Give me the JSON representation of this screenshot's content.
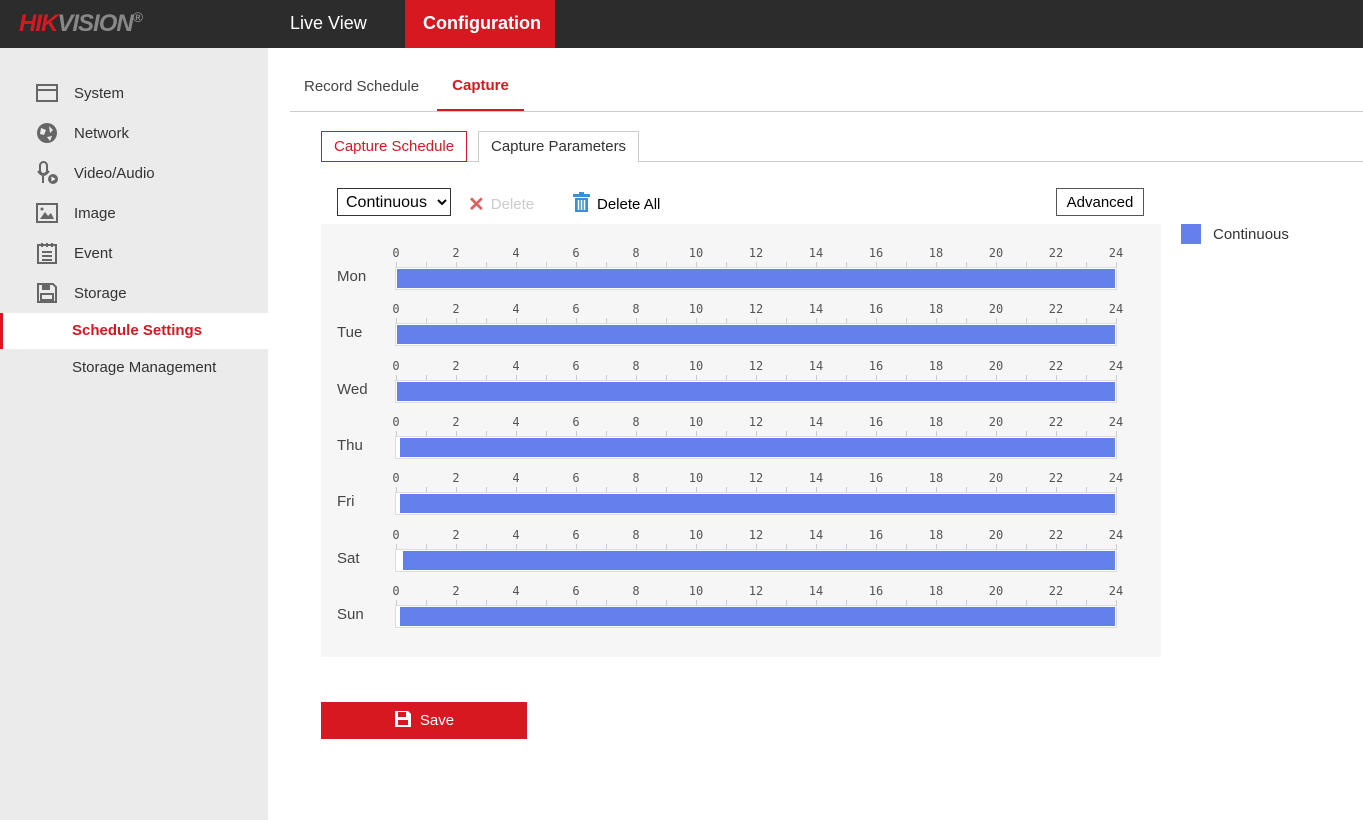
{
  "header": {
    "logo": "HIKVISION",
    "nav": [
      {
        "label": "Live View"
      },
      {
        "label": "Configuration",
        "active": true
      }
    ]
  },
  "sidebar": {
    "items": [
      {
        "label": "System",
        "icon": "window-icon"
      },
      {
        "label": "Network",
        "icon": "globe-icon"
      },
      {
        "label": "Video/Audio",
        "icon": "microphone-icon"
      },
      {
        "label": "Image",
        "icon": "image-icon"
      },
      {
        "label": "Event",
        "icon": "calendar-icon"
      },
      {
        "label": "Storage",
        "icon": "floppy-icon"
      }
    ],
    "subitems": [
      {
        "label": "Schedule Settings",
        "active": true
      },
      {
        "label": "Storage Management"
      }
    ]
  },
  "tabs": [
    {
      "label": "Record Schedule"
    },
    {
      "label": "Capture",
      "active": true
    }
  ],
  "subtabs": [
    {
      "label": "Capture Schedule",
      "active": true
    },
    {
      "label": "Capture Parameters"
    }
  ],
  "toolbar": {
    "mode": "Continuous",
    "delete": "Delete",
    "delete_all": "Delete All",
    "advanced": "Advanced"
  },
  "legend": {
    "label": "Continuous",
    "color": "#6480ea"
  },
  "schedule": {
    "hour_ticks": [
      "0",
      "2",
      "4",
      "6",
      "8",
      "10",
      "12",
      "14",
      "16",
      "18",
      "20",
      "22",
      "24"
    ],
    "days": [
      {
        "day": "Mon",
        "start": 0,
        "end": 24
      },
      {
        "day": "Tue",
        "start": 0,
        "end": 24
      },
      {
        "day": "Wed",
        "start": 0,
        "end": 24
      },
      {
        "day": "Thu",
        "start": 0.1,
        "end": 24
      },
      {
        "day": "Fri",
        "start": 0.1,
        "end": 24
      },
      {
        "day": "Sat",
        "start": 0.2,
        "end": 24
      },
      {
        "day": "Sun",
        "start": 0.1,
        "end": 24
      }
    ]
  },
  "save_label": "Save"
}
